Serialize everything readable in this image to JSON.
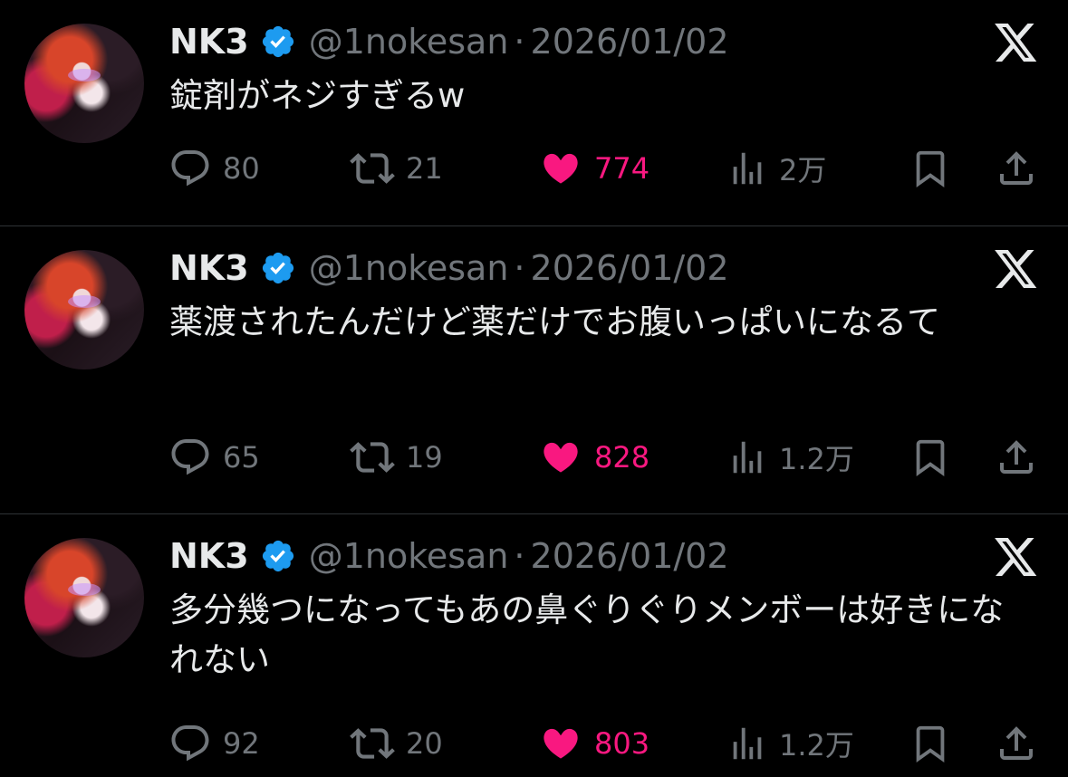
{
  "colors": {
    "background": "#000000",
    "text": "#e7e9ea",
    "muted": "#71767b",
    "like": "#f91880",
    "verified": "#1d9bf0",
    "divider": "#2f3336"
  },
  "tweets": [
    {
      "name": "NK3",
      "handle": "@1nokesan",
      "separator": "·",
      "date": "2026/01/02",
      "text": "錠剤がネジすぎるw",
      "replies": "80",
      "retweets": "21",
      "likes": "774",
      "views": "2万"
    },
    {
      "name": "NK3",
      "handle": "@1nokesan",
      "separator": "·",
      "date": "2026/01/02",
      "text": "薬渡されたんだけど薬だけでお腹いっぱいになるて",
      "replies": "65",
      "retweets": "19",
      "likes": "828",
      "views": "1.2万"
    },
    {
      "name": "NK3",
      "handle": "@1nokesan",
      "separator": "·",
      "date": "2026/01/02",
      "text": "多分幾つになってもあの鼻ぐりぐりメンボーは好きになれない",
      "replies": "92",
      "retweets": "20",
      "likes": "803",
      "views": "1.2万"
    }
  ],
  "icons": {
    "verified": "verified-badge-icon",
    "platform": "x-logo-icon",
    "reply": "reply-bubble-icon",
    "retweet": "retweet-icon",
    "like": "heart-filled-icon",
    "views": "views-bar-chart-icon",
    "bookmark": "bookmark-icon",
    "share": "share-upload-icon"
  }
}
